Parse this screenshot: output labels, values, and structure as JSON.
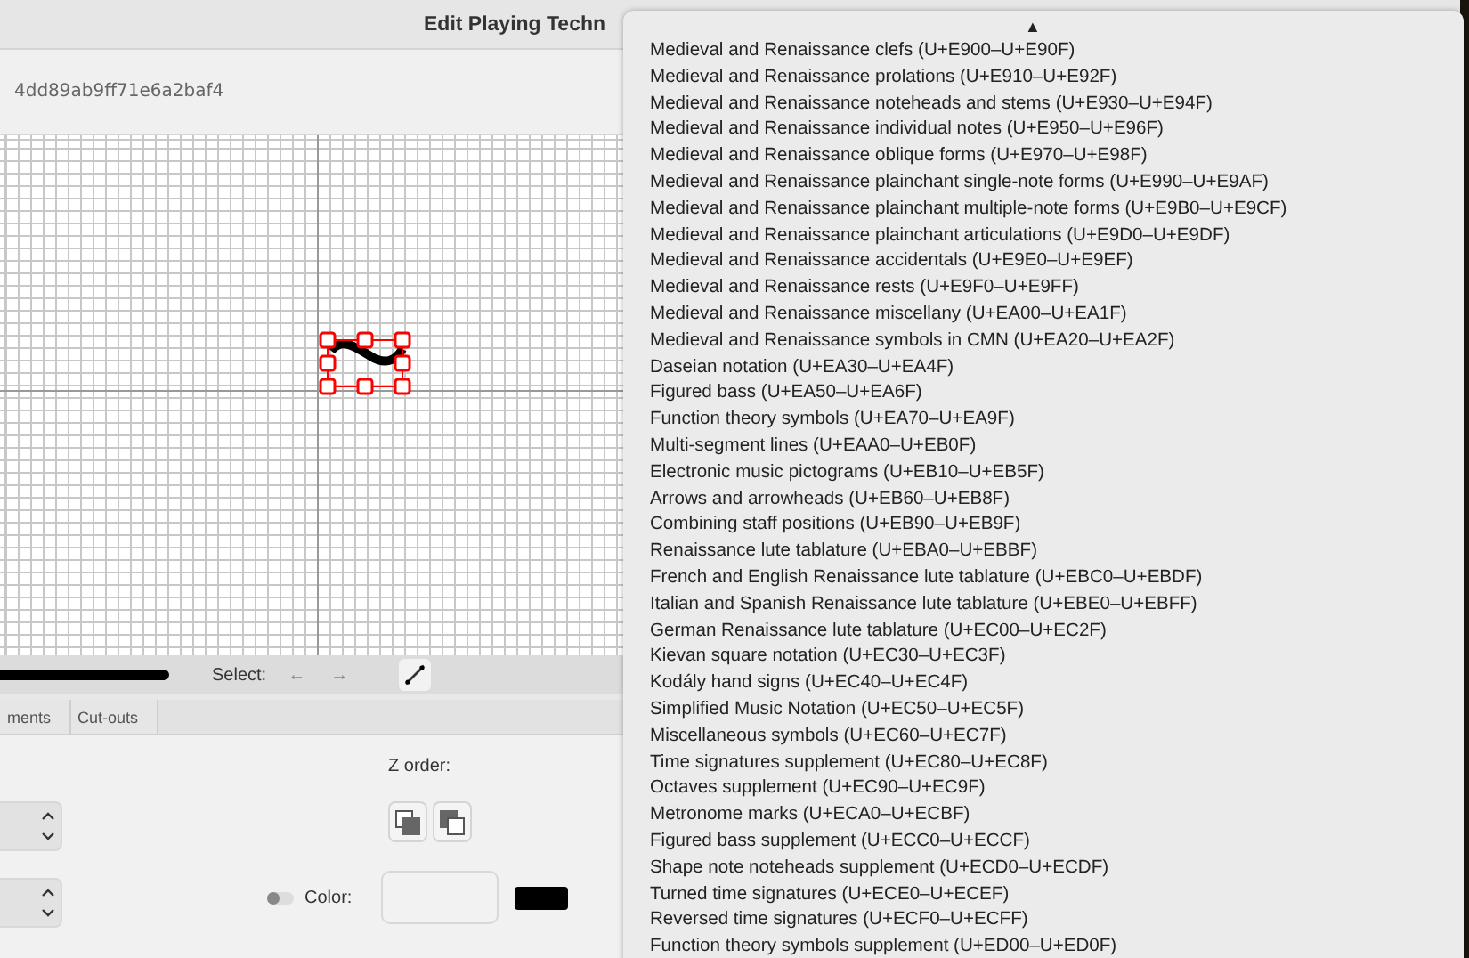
{
  "window": {
    "title": "Edit Playing Techn"
  },
  "id_field": {
    "value": "4dd89ab9ff71e6a2baf4"
  },
  "toolbar": {
    "select_label": "Select:",
    "prev": "←",
    "next": "→"
  },
  "tabs": [
    {
      "label": "ments",
      "selected": false
    },
    {
      "label": "Cut-outs",
      "selected": false
    }
  ],
  "z_order": {
    "label": "Z order:"
  },
  "color": {
    "on": false,
    "label": "Color:"
  },
  "menu": {
    "scroll_up": "▲",
    "items": [
      "Medieval and Renaissance clefs (U+E900–U+E90F)",
      "Medieval and Renaissance prolations (U+E910–U+E92F)",
      "Medieval and Renaissance noteheads and stems (U+E930–U+E94F)",
      "Medieval and Renaissance individual notes (U+E950–U+E96F)",
      "Medieval and Renaissance oblique forms (U+E970–U+E98F)",
      "Medieval and Renaissance plainchant single-note forms (U+E990–U+E9AF)",
      "Medieval and Renaissance plainchant multiple-note forms (U+E9B0–U+E9CF)",
      "Medieval and Renaissance plainchant articulations (U+E9D0–U+E9DF)",
      "Medieval and Renaissance accidentals (U+E9E0–U+E9EF)",
      "Medieval and Renaissance rests (U+E9F0–U+E9FF)",
      "Medieval and Renaissance miscellany (U+EA00–U+EA1F)",
      "Medieval and Renaissance symbols in CMN (U+EA20–U+EA2F)",
      "Daseian notation (U+EA30–U+EA4F)",
      "Figured bass (U+EA50–U+EA6F)",
      "Function theory symbols (U+EA70–U+EA9F)",
      "Multi-segment lines (U+EAA0–U+EB0F)",
      "Electronic music pictograms (U+EB10–U+EB5F)",
      "Arrows and arrowheads (U+EB60–U+EB8F)",
      "Combining staff positions (U+EB90–U+EB9F)",
      "Renaissance lute tablature (U+EBA0–U+EBBF)",
      "French and English Renaissance lute tablature (U+EBC0–U+EBDF)",
      "Italian and Spanish Renaissance lute tablature (U+EBE0–U+EBFF)",
      "German Renaissance lute tablature (U+EC00–U+EC2F)",
      "Kievan square notation (U+EC30–U+EC3F)",
      "Kodály hand signs (U+EC40–U+EC4F)",
      "Simplified Music Notation (U+EC50–U+EC5F)",
      "Miscellaneous symbols (U+EC60–U+EC7F)",
      "Time signatures supplement (U+EC80–U+EC8F)",
      "Octaves supplement (U+EC90–U+EC9F)",
      "Metronome marks (U+ECA0–U+ECBF)",
      "Figured bass supplement (U+ECC0–U+ECCF)",
      "Shape note noteheads supplement (U+ECD0–U+ECDF)",
      "Turned time signatures (U+ECE0–U+ECEF)",
      "Reversed time signatures (U+ECF0–U+ECFF)",
      "Function theory symbols supplement (U+ED00–U+ED0F)"
    ]
  }
}
